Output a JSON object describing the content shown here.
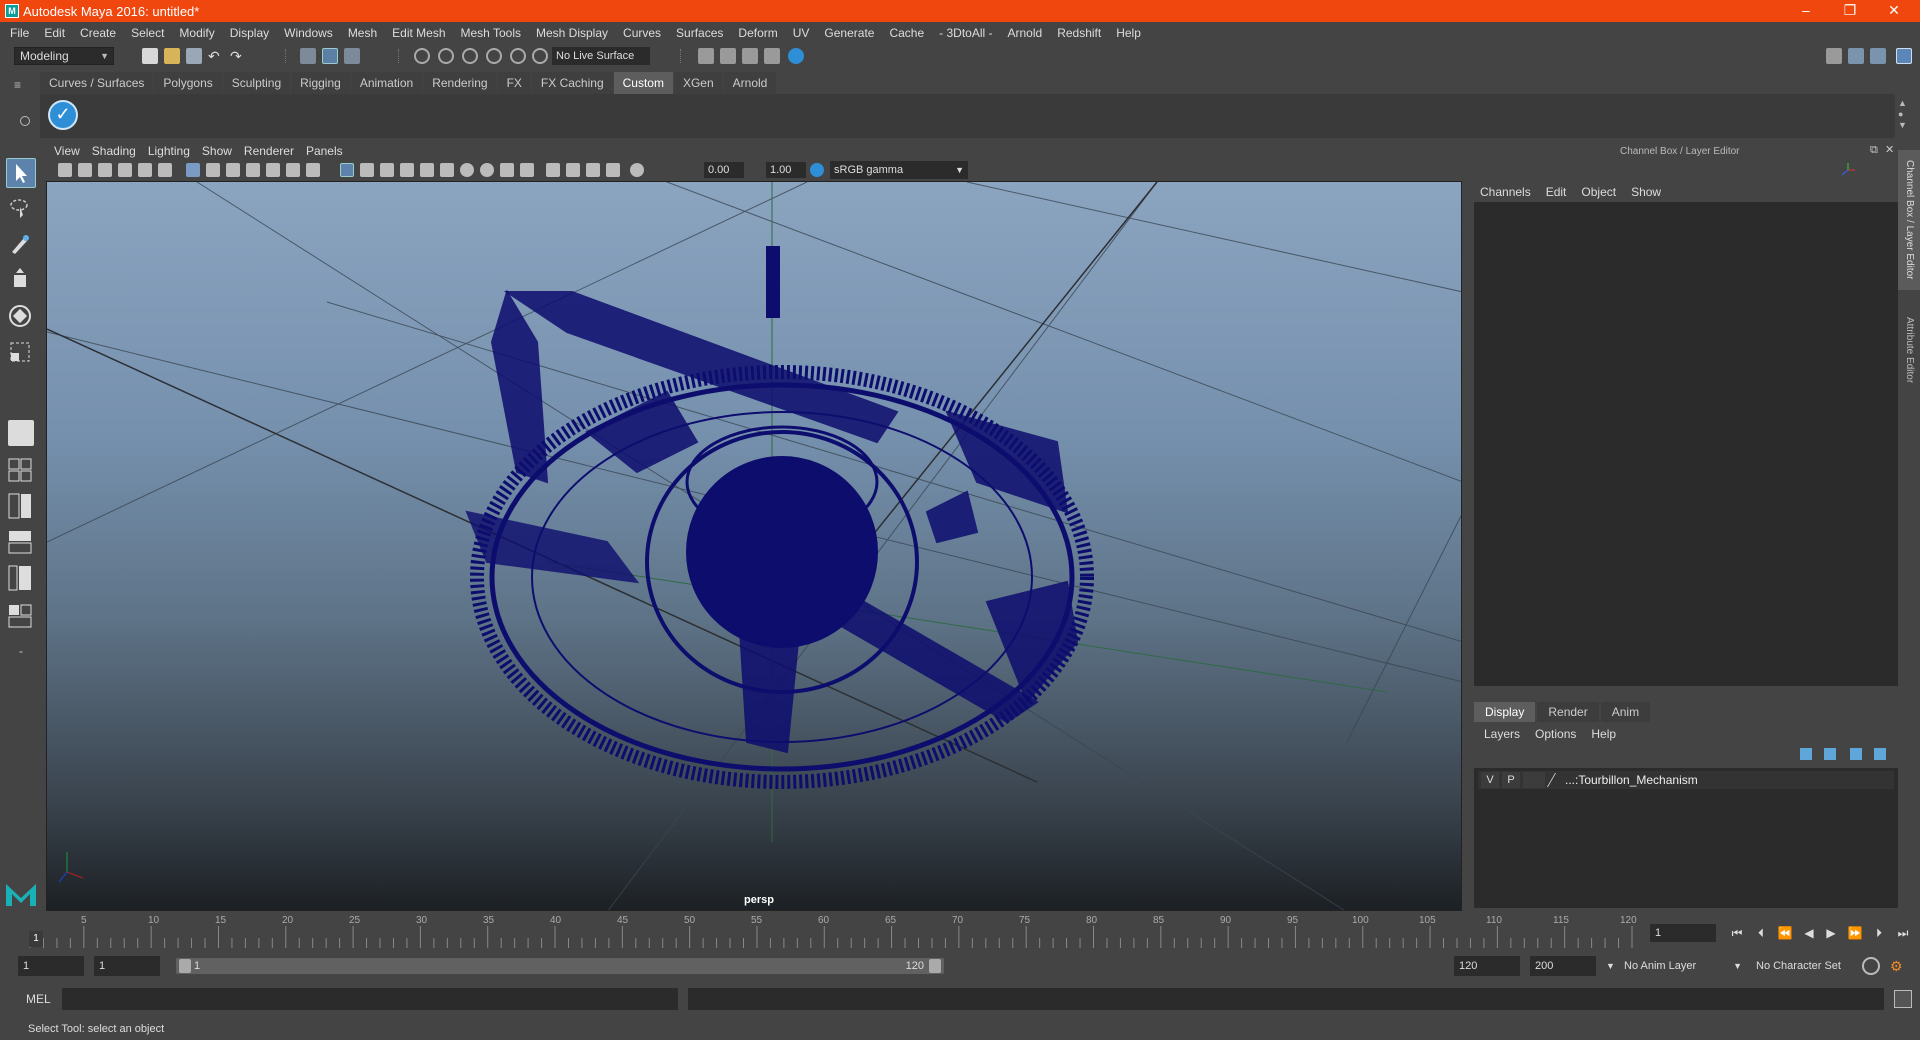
{
  "window": {
    "title": "Autodesk Maya 2016: untitled*",
    "icon": "maya-icon",
    "minimize": "–",
    "maximize": "❐",
    "close": "✕"
  },
  "menubar": [
    "File",
    "Edit",
    "Create",
    "Select",
    "Modify",
    "Display",
    "Windows",
    "Mesh",
    "Edit Mesh",
    "Mesh Tools",
    "Mesh Display",
    "Curves",
    "Surfaces",
    "Deform",
    "UV",
    "Generate",
    "Cache",
    "- 3DtoAll -",
    "Arnold",
    "Redshift",
    "Help"
  ],
  "toolbar": {
    "mode": "Modeling",
    "live_surface": "No Live Surface"
  },
  "shelf": {
    "tabs": [
      "Curves / Surfaces",
      "Polygons",
      "Sculpting",
      "Rigging",
      "Animation",
      "Rendering",
      "FX",
      "FX Caching",
      "Custom",
      "XGen",
      "Arnold"
    ],
    "active_tab": "Custom"
  },
  "panel": {
    "menus": [
      "View",
      "Shading",
      "Lighting",
      "Show",
      "Renderer",
      "Panels"
    ],
    "near_value": "0.00",
    "far_value": "1.00",
    "color_space": "sRGB gamma",
    "camera_label": "persp"
  },
  "channel_box": {
    "title": "Channel Box / Layer Editor",
    "menus": [
      "Channels",
      "Edit",
      "Object",
      "Show"
    ],
    "side_tab_1": "Channel Box / Layer Editor",
    "side_tab_2": "Attribute Editor"
  },
  "layer_editor": {
    "tabs": [
      "Display",
      "Render",
      "Anim"
    ],
    "active_tab": "Display",
    "menus": [
      "Layers",
      "Options",
      "Help"
    ],
    "layers": [
      {
        "visible": "V",
        "playback": "P",
        "name": "...:Tourbillon_Mechanism"
      }
    ]
  },
  "timeline": {
    "ticks": [
      "5",
      "10",
      "15",
      "20",
      "25",
      "30",
      "35",
      "40",
      "45",
      "50",
      "55",
      "60",
      "65",
      "70",
      "75",
      "80",
      "85",
      "90",
      "95",
      "100",
      "105",
      "110",
      "115",
      "120"
    ],
    "current_frame": "1",
    "frame_field": "1"
  },
  "range": {
    "start": "1",
    "playback_start": "1",
    "slider_start": "1",
    "slider_end": "120",
    "playback_end": "120",
    "end": "200",
    "anim_layer": "No Anim Layer",
    "character_set": "No Character Set"
  },
  "command": {
    "label": "MEL"
  },
  "help_line": "Select Tool: select an object",
  "colors": {
    "titlebar": "#f0470e",
    "wireframe": "#0d0d6e",
    "accent": "#2f8fd6"
  }
}
